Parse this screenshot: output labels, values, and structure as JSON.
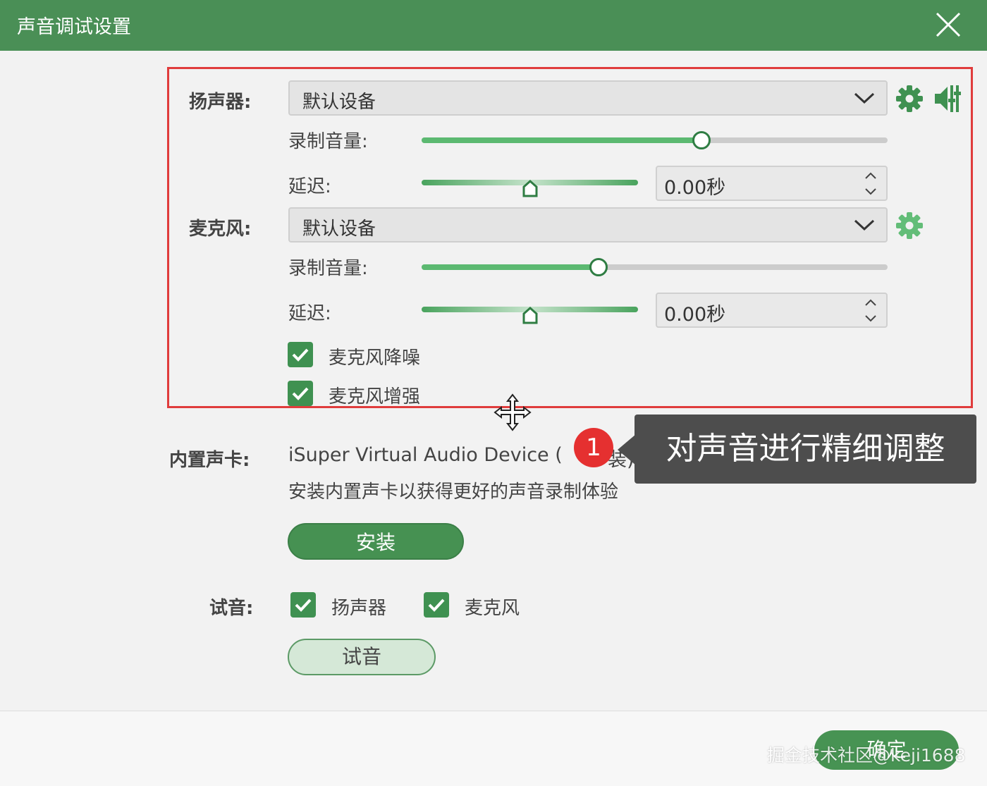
{
  "window": {
    "title": "声音调试设置"
  },
  "speaker": {
    "label": "扬声器:",
    "device": "默认设备",
    "volume_label": "录制音量:",
    "volume_level": 0.6,
    "delay_label": "延迟:",
    "delay_value": "0.00秒"
  },
  "microphone": {
    "label": "麦克风:",
    "device": "默认设备",
    "volume_label": "录制音量:",
    "volume_level": 0.38,
    "delay_label": "延迟:",
    "delay_value": "0.00秒",
    "noise_reduction_label": "麦克风降噪",
    "noise_reduction_checked": true,
    "enhance_label": "麦克风增强",
    "enhance_checked": true
  },
  "soundcard": {
    "label": "内置声卡:",
    "device_name": "iSuper Virtual Audio Device (",
    "device_suffix": "装)",
    "hint": "安装内置声卡以获得更好的声音录制体验",
    "install_label": "安装"
  },
  "test": {
    "label": "试音:",
    "speaker_label": "扬声器",
    "speaker_checked": true,
    "mic_label": "麦克风",
    "mic_checked": true,
    "button_label": "试音"
  },
  "footer": {
    "ok_label": "确定"
  },
  "annotation": {
    "badge": "1",
    "tooltip": "对声音进行精细调整"
  },
  "watermark": "掘金技术社区@keji1688",
  "colors": {
    "titlebar": "#4a8f56",
    "accent": "#469152",
    "highlight_box": "#e03c3c",
    "slider_fill": "#5cb971"
  }
}
